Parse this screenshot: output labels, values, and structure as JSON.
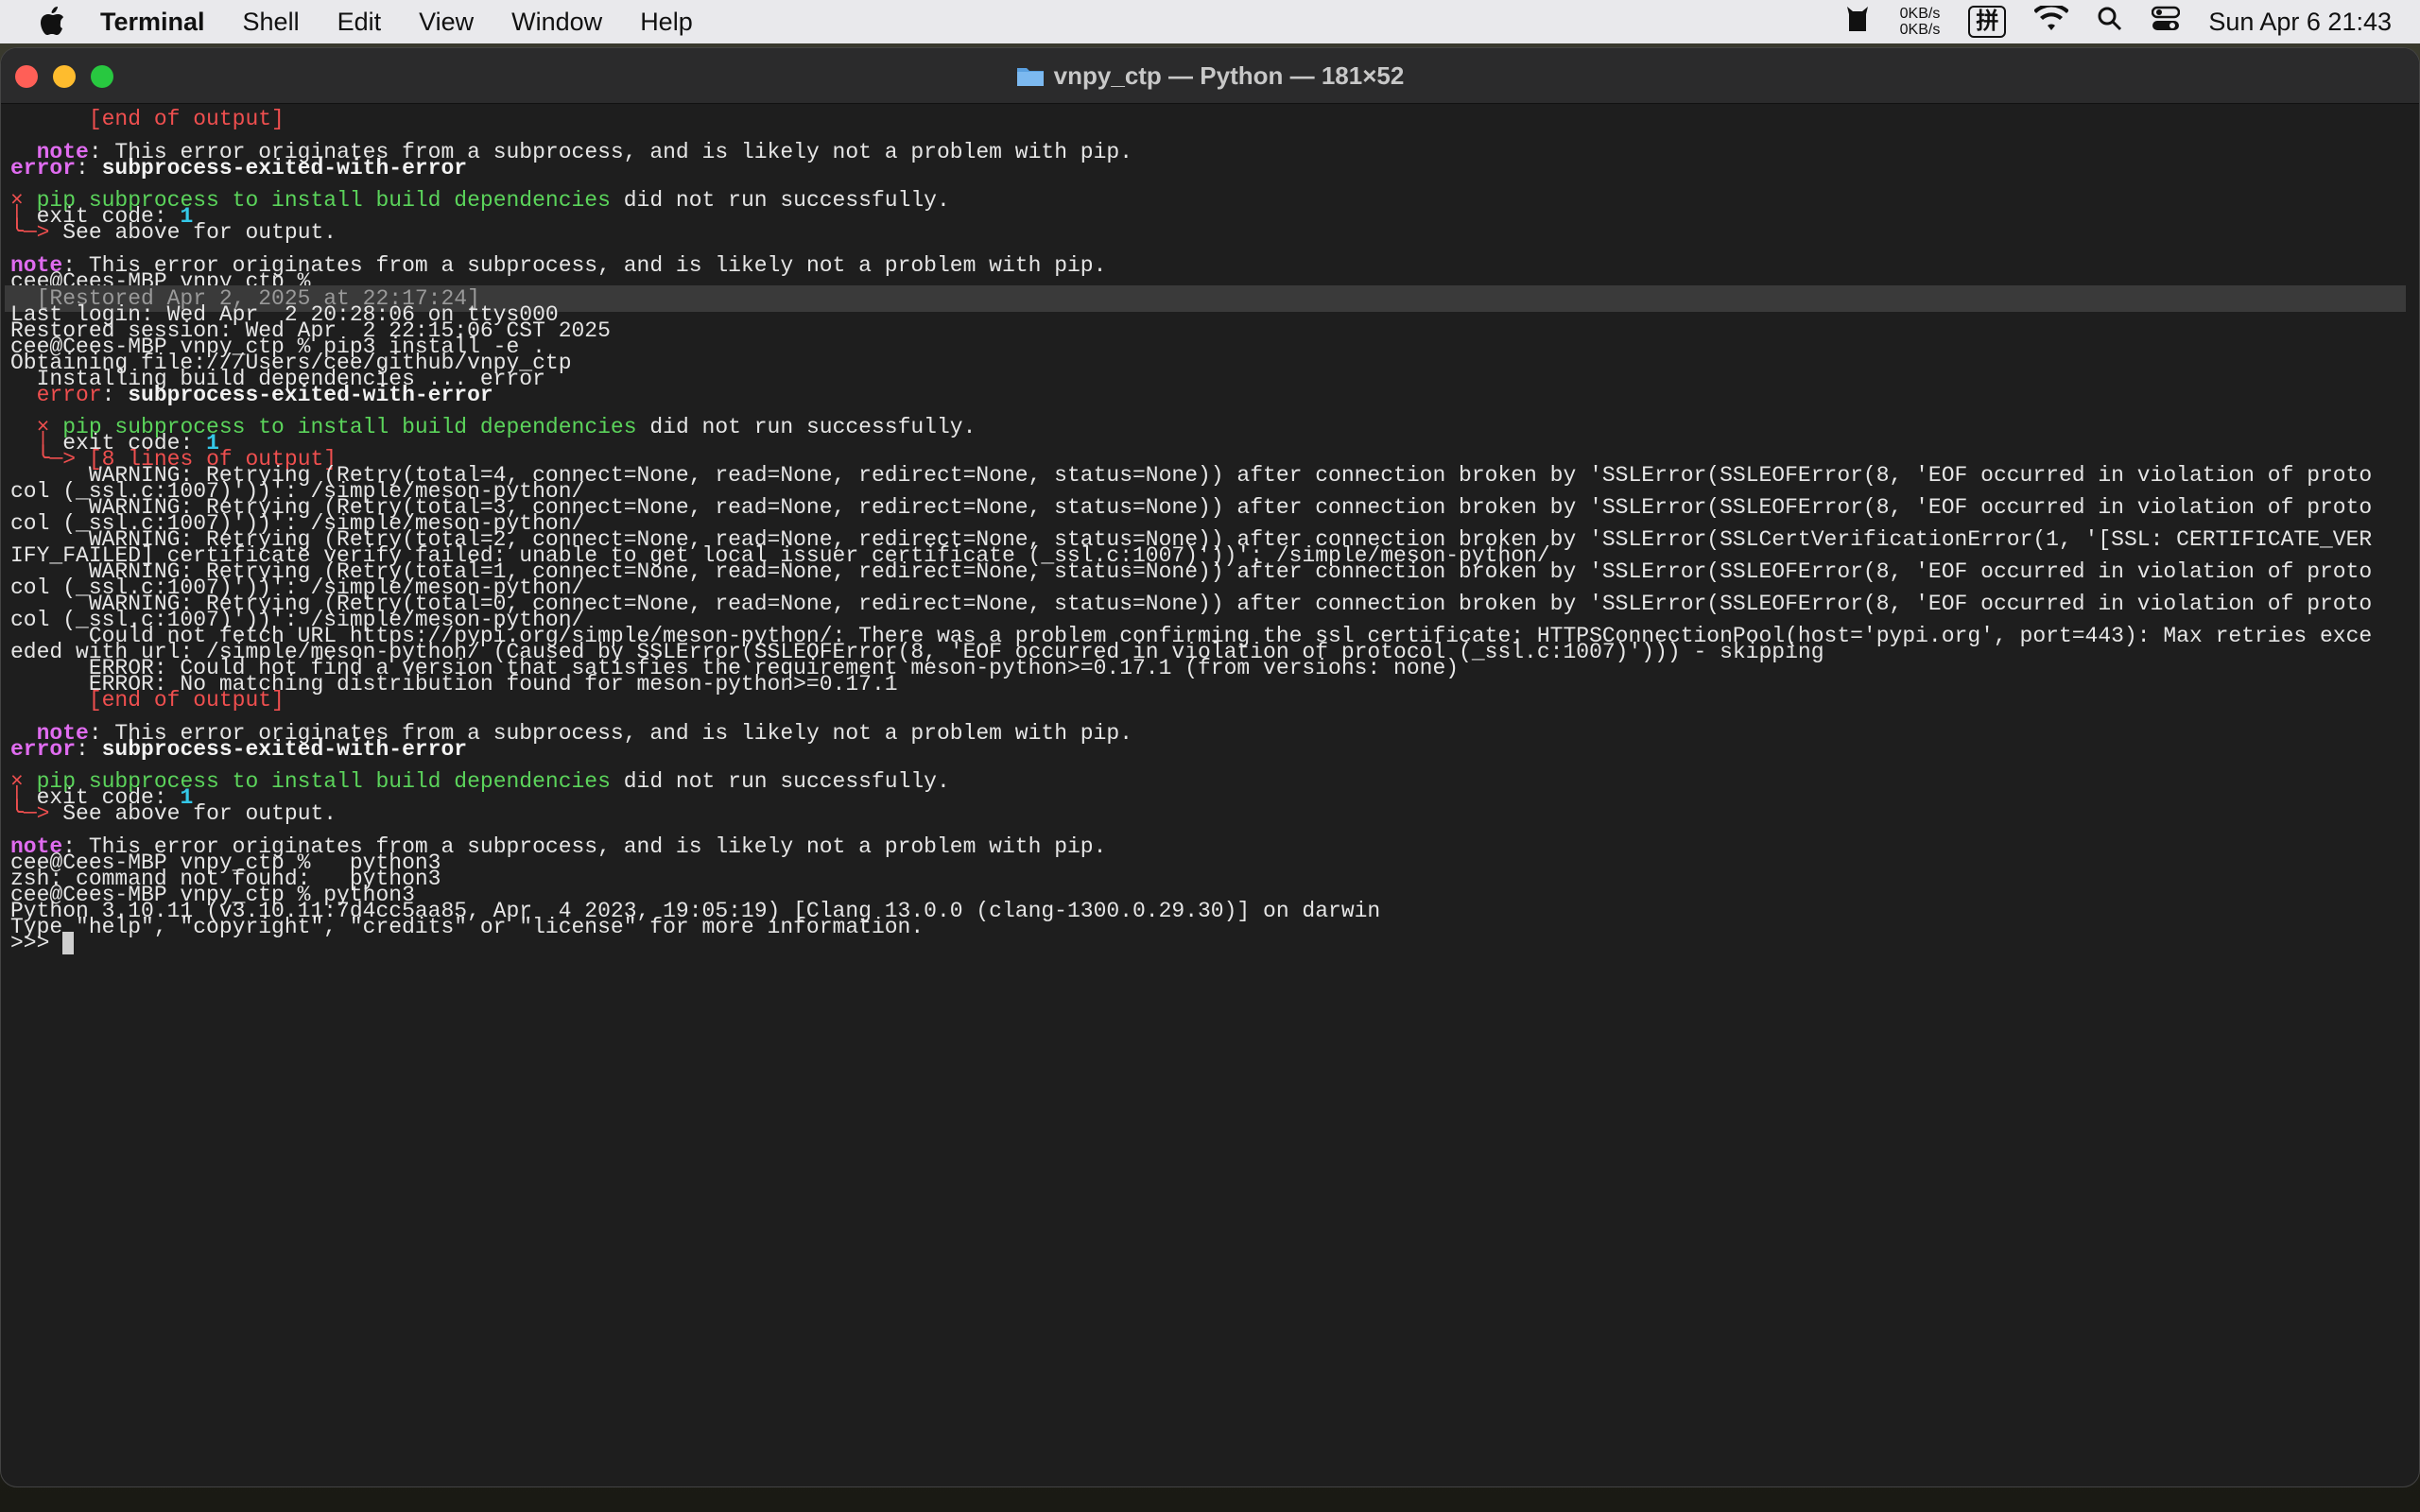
{
  "menubar": {
    "app": "Terminal",
    "items": [
      "Shell",
      "Edit",
      "View",
      "Window",
      "Help"
    ],
    "net_up": "0KB/s",
    "net_down": "0KB/s",
    "input_method": "拼",
    "clock": "Sun Apr 6  21:43"
  },
  "window": {
    "title": "vnpy_ctp — Python — 181×52"
  },
  "terminal": {
    "lines": {
      "l1": "      [end of output]",
      "l2a": "  note",
      "l2b": ": This error originates from a subprocess, and is likely not a problem with pip.",
      "l3a": "error",
      "l3b": ": ",
      "l3c": "subprocess-exited-with-error",
      "l4a": "×",
      "l4b": " pip subprocess to install build dependencies",
      "l4c": " did not run successfully.",
      "l5a": "│",
      "l5b": " exit code: ",
      "l5c": "1",
      "l6a": "╰─>",
      "l6b": " See above for output.",
      "l7a": "note",
      "l7b": ": This error originates from a subprocess, and is likely not a problem with pip.",
      "l8": "cee@Cees-MBP vnpy_ctp %",
      "restored": "  [Restored Apr 2, 2025 at 22:17:24]",
      "l10": "Last login: Wed Apr  2 20:28:06 on ttys000",
      "l11": "Restored session: Wed Apr  2 22:15:06 CST 2025",
      "l12": "cee@Cees-MBP vnpy_ctp % pip3 install -e .",
      "l13": "Obtaining file:///Users/cee/github/vnpy_ctp",
      "l14": "  Installing build dependencies ... error",
      "l15a": "  error",
      "l15b": ": ",
      "l15c": "subprocess-exited-with-error",
      "l16a": "  ×",
      "l16b": " pip subprocess to install build dependencies",
      "l16c": " did not run successfully.",
      "l17a": "  │",
      "l17b": " exit code: ",
      "l17c": "1",
      "l18a": "  ╰─>",
      "l18b": " [8 lines of output]",
      "w1a": "      WARNING: Retrying (Retry(total=4, connect=None, read=None, redirect=None, status=None)) after connection broken by 'SSLError(SSLEOFError(8, 'EOF occurred in violation of proto",
      "w1b": "col (_ssl.c:1007)'))': /simple/meson-python/",
      "w2a": "      WARNING: Retrying (Retry(total=3, connect=None, read=None, redirect=None, status=None)) after connection broken by 'SSLError(SSLEOFError(8, 'EOF occurred in violation of proto",
      "w2b": "col (_ssl.c:1007)'))': /simple/meson-python/",
      "w3a": "      WARNING: Retrying (Retry(total=2, connect=None, read=None, redirect=None, status=None)) after connection broken by 'SSLError(SSLCertVerificationError(1, '[SSL: CERTIFICATE_VER",
      "w3b": "IFY_FAILED] certificate verify failed: unable to get local issuer certificate (_ssl.c:1007)'))': /simple/meson-python/",
      "w4a": "      WARNING: Retrying (Retry(total=1, connect=None, read=None, redirect=None, status=None)) after connection broken by 'SSLError(SSLEOFError(8, 'EOF occurred in violation of proto",
      "w4b": "col (_ssl.c:1007)'))': /simple/meson-python/",
      "w5a": "      WARNING: Retrying (Retry(total=0, connect=None, read=None, redirect=None, status=None)) after connection broken by 'SSLError(SSLEOFError(8, 'EOF occurred in violation of proto",
      "w5b": "col (_ssl.c:1007)'))': /simple/meson-python/",
      "f1a": "      Could not fetch URL https://pypi.org/simple/meson-python/: There was a problem confirming the ssl certificate: HTTPSConnectionPool(host='pypi.org', port=443): Max retries exce",
      "f1b": "eded with url: /simple/meson-python/ (Caused by SSLError(SSLEOFError(8, 'EOF occurred in violation of protocol (_ssl.c:1007)'))) - skipping",
      "e1": "      ERROR: Could not find a version that satisfies the requirement meson-python>=0.17.1 (from versions: none)",
      "e2": "      ERROR: No matching distribution found for meson-python>=0.17.1",
      "eo": "      [end of output]",
      "n2a": "  note",
      "n2b": ": This error originates from a subprocess, and is likely not a problem with pip.",
      "x2a": "error",
      "x2b": ": ",
      "x2c": "subprocess-exited-with-error",
      "p2a": "×",
      "p2b": " pip subprocess to install build dependencies",
      "p2c": " did not run successfully.",
      "c2a": "│",
      "c2b": " exit code: ",
      "c2c": "1",
      "s2a": "╰─>",
      "s2b": " See above for output.",
      "n3a": "note",
      "n3b": ": This error originates from a subprocess, and is likely not a problem with pip.",
      "z1": "cee@Cees-MBP vnpy_ctp %   python3",
      "z2": "zsh: command not found:   python3",
      "z3": "cee@Cees-MBP vnpy_ctp % python3",
      "py1": "Python 3.10.11 (v3.10.11:7d4cc5aa85, Apr  4 2023, 19:05:19) [Clang 13.0.0 (clang-1300.0.29.30)] on darwin",
      "py2": "Type \"help\", \"copyright\", \"credits\" or \"license\" for more information.",
      "prompt": ">>> "
    }
  },
  "colors": {
    "error_red": "#ef4f4f",
    "note_magenta": "#e06cf0",
    "green": "#5bd45b",
    "cyan": "#34c8e8"
  }
}
